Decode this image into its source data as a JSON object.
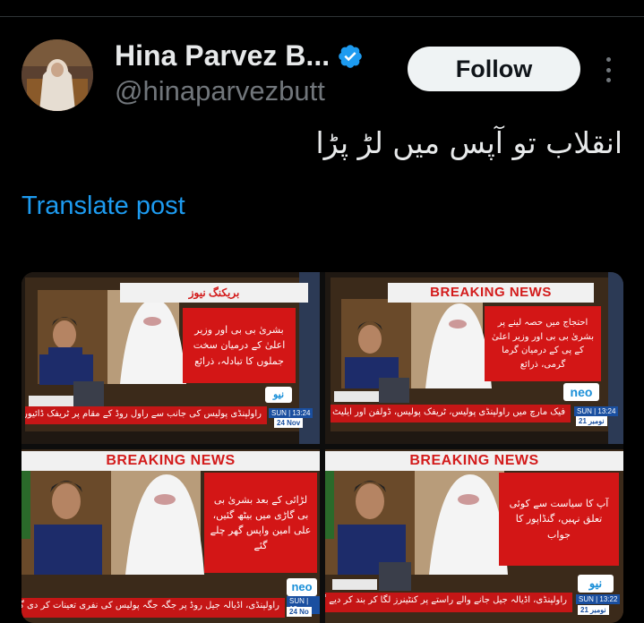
{
  "author": {
    "display_name": "Hina Parvez B...",
    "handle": "@hinaparvezbutt",
    "verified": true,
    "verified_color": "#1d9bf0"
  },
  "actions": {
    "follow_label": "Follow",
    "more_icon": "more-vertical-icon"
  },
  "post": {
    "text": "انقلاب تو آپس میں لڑ پڑا",
    "translate_label": "Translate post"
  },
  "media": {
    "tiles": [
      {
        "banner": "بریکنگ نیوز",
        "headline": "بشریٰ بی بی اور وزیر اعلیٰ کے درمیان سخت جملوں کا تبادلہ، ذرائع",
        "ticker": "راولپنڈی پولیس کی جانب سے راول روڈ کے مقام پر ٹریفک ڈائیورٹ کر دیا گیا",
        "logo": "نیو",
        "clock": "SUN | 13:24",
        "date": "24 Nov"
      },
      {
        "banner": "BREAKING NEWS",
        "headline": "احتجاج میں حصہ لینے پر بشریٰ بی بی اور وزیر اعلیٰ کے پی کے درمیان گرما گرمی، ذرائع",
        "ticker": "فیک مارچ میں راولپنڈی پولیس، ٹریفک پولیس، ڈولفن اور ایلیٹ فورس شریک",
        "logo": "neo",
        "clock": "SUN | 13:24",
        "date": "21 نومبر"
      },
      {
        "banner": "BREAKING NEWS",
        "headline": "لڑائی کے بعد بشریٰ بی بی گاڑی میں بیٹھ گئیں، علی امین واپس گھر چلے گئے",
        "ticker": "راولپنڈی، اڈیالہ جیل روڈ پر جگہ جگہ پولیس کی نفری تعینات کر دی گئی",
        "logo": "neo",
        "clock": "SUN | 13",
        "date": "24 No"
      },
      {
        "banner": "BREAKING NEWS",
        "headline": "آپ کا سیاست سے کوئی تعلق نہیں، گنڈاپور کا جواب",
        "ticker": "راولپنڈی، اڈیالہ جیل جانے والے راستے پر کنٹینرز لگا کر بند کر دیے گئے",
        "logo": "نیو",
        "clock": "SUN | 13:22",
        "date": "21 نومبر"
      }
    ]
  },
  "colors": {
    "background": "#000000",
    "accent": "#1d9bf0",
    "follow_bg": "#eff3f4",
    "news_red": "#d31616"
  }
}
